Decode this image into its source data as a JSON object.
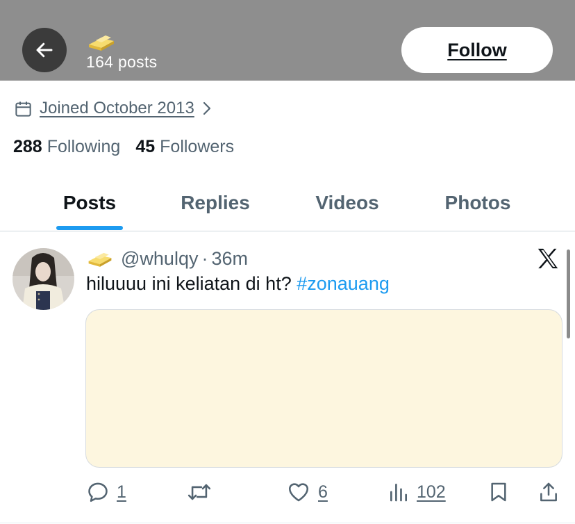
{
  "header": {
    "posts_count": "164 posts",
    "follow_label": "Follow",
    "emoji_icon": "butter-icon"
  },
  "profile": {
    "joined_text": "Joined October 2013",
    "following_count": "288",
    "following_label": "Following",
    "followers_count": "45",
    "followers_label": "Followers"
  },
  "tabs": [
    {
      "label": "Posts",
      "active": true
    },
    {
      "label": "Replies",
      "active": false
    },
    {
      "label": "Videos",
      "active": false
    },
    {
      "label": "Photos",
      "active": false
    }
  ],
  "post": {
    "handle": "@whulqy",
    "separator": "·",
    "time": "36m",
    "text": "hiluuuu ini keliatan di ht? ",
    "hashtag": "#zonauang",
    "actions": {
      "replies": "1",
      "likes": "6",
      "views": "102"
    }
  },
  "colors": {
    "header_bg": "#8e8e8e",
    "accent": "#1d9bf0",
    "muted_text": "#536471",
    "media_bg": "#fdf6df"
  }
}
